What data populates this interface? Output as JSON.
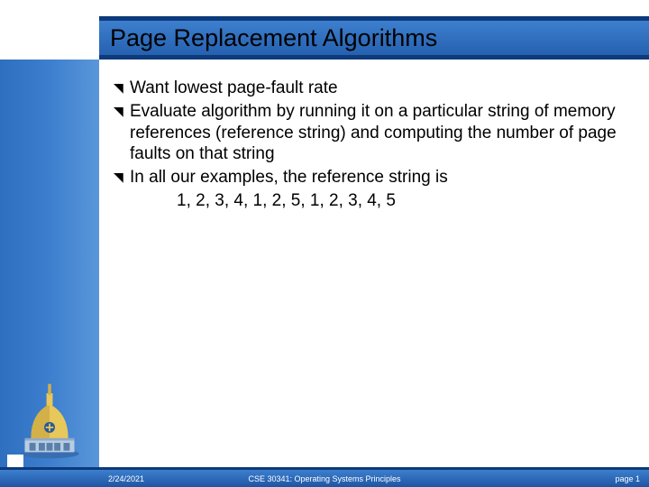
{
  "title": "Page Replacement Algorithms",
  "bullets": {
    "b0": "Want lowest page-fault rate",
    "b1": "Evaluate algorithm by running it on a particular string of memory references (reference string) and computing the number of page faults on that string",
    "b2": "In all our examples, the reference string is"
  },
  "reference_string": "1, 2, 3, 4, 1, 2, 5, 1, 2, 3, 4, 5",
  "footer": {
    "date": "2/24/2021",
    "course": "CSE 30341: Operating Systems Principles",
    "page": "page 1"
  }
}
